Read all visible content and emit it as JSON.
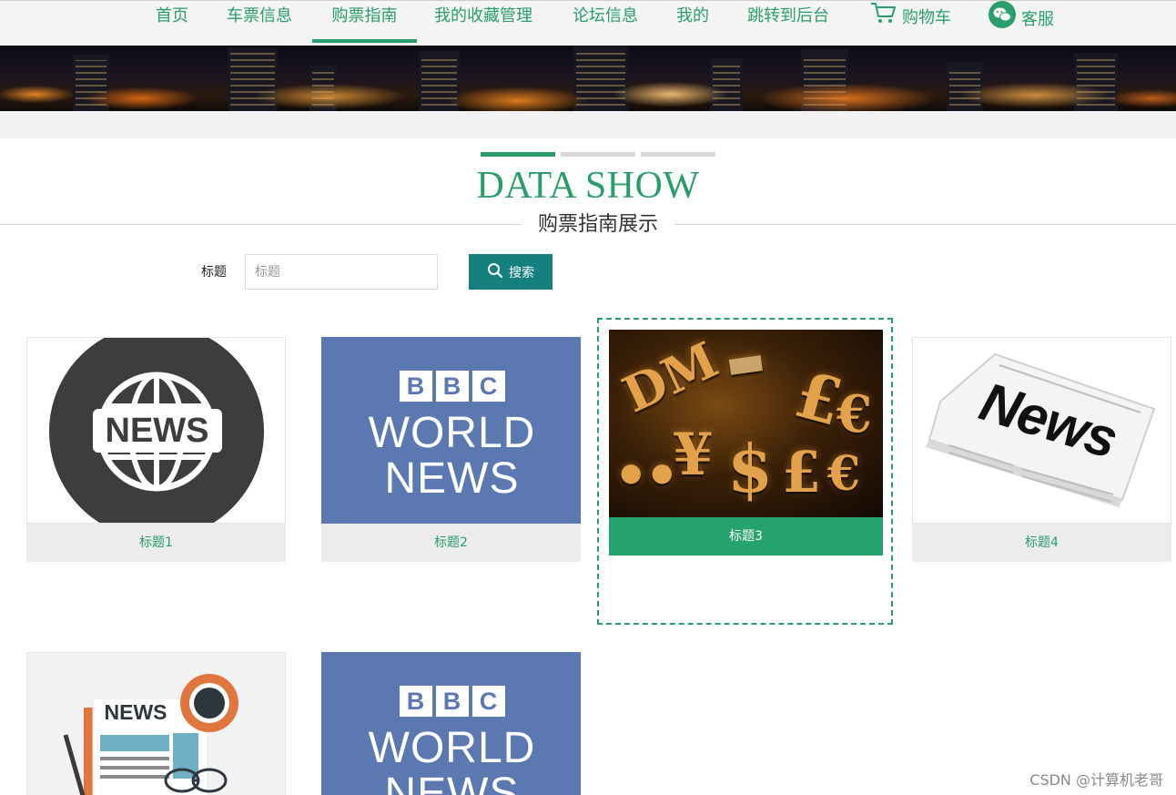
{
  "nav": {
    "items": [
      {
        "label": "首页"
      },
      {
        "label": "车票信息"
      },
      {
        "label": "购票指南",
        "active": true
      },
      {
        "label": "我的收藏管理"
      },
      {
        "label": "论坛信息"
      },
      {
        "label": "我的"
      },
      {
        "label": "跳转到后台"
      },
      {
        "label": "购物车",
        "icon": "cart-icon"
      },
      {
        "label": "客服",
        "icon": "wechat-icon"
      }
    ]
  },
  "section": {
    "title": "DATA SHOW",
    "subtitle": "购票指南展示"
  },
  "search": {
    "label": "标题",
    "placeholder": "标题",
    "value": "",
    "button_label": "搜索",
    "button_icon": "search-icon"
  },
  "cards": [
    {
      "title": "标题1",
      "image": "news-globe-icon",
      "image_text": "NEWS"
    },
    {
      "title": "标题2",
      "image": "bbc-world-news-logo",
      "image_text": [
        "BBC",
        "WORLD",
        "NEWS"
      ]
    },
    {
      "title": "标题3",
      "image": "gold-currency-symbols",
      "active": true
    },
    {
      "title": "标题4",
      "image": "newspaper-news",
      "image_text": "News"
    },
    {
      "title": "",
      "image": "news-flat-illustration",
      "image_text": "NEWS"
    },
    {
      "title": "",
      "image": "bbc-world-news-logo",
      "image_text": [
        "BBC",
        "WORLD",
        "NEWS"
      ]
    }
  ],
  "watermark": "CSDN @计算机老哥",
  "colors": {
    "accent": "#2a9d6c",
    "search_button": "#15807e",
    "active_card_label": "#25a26e",
    "bbc_blue": "#5b79b0"
  }
}
